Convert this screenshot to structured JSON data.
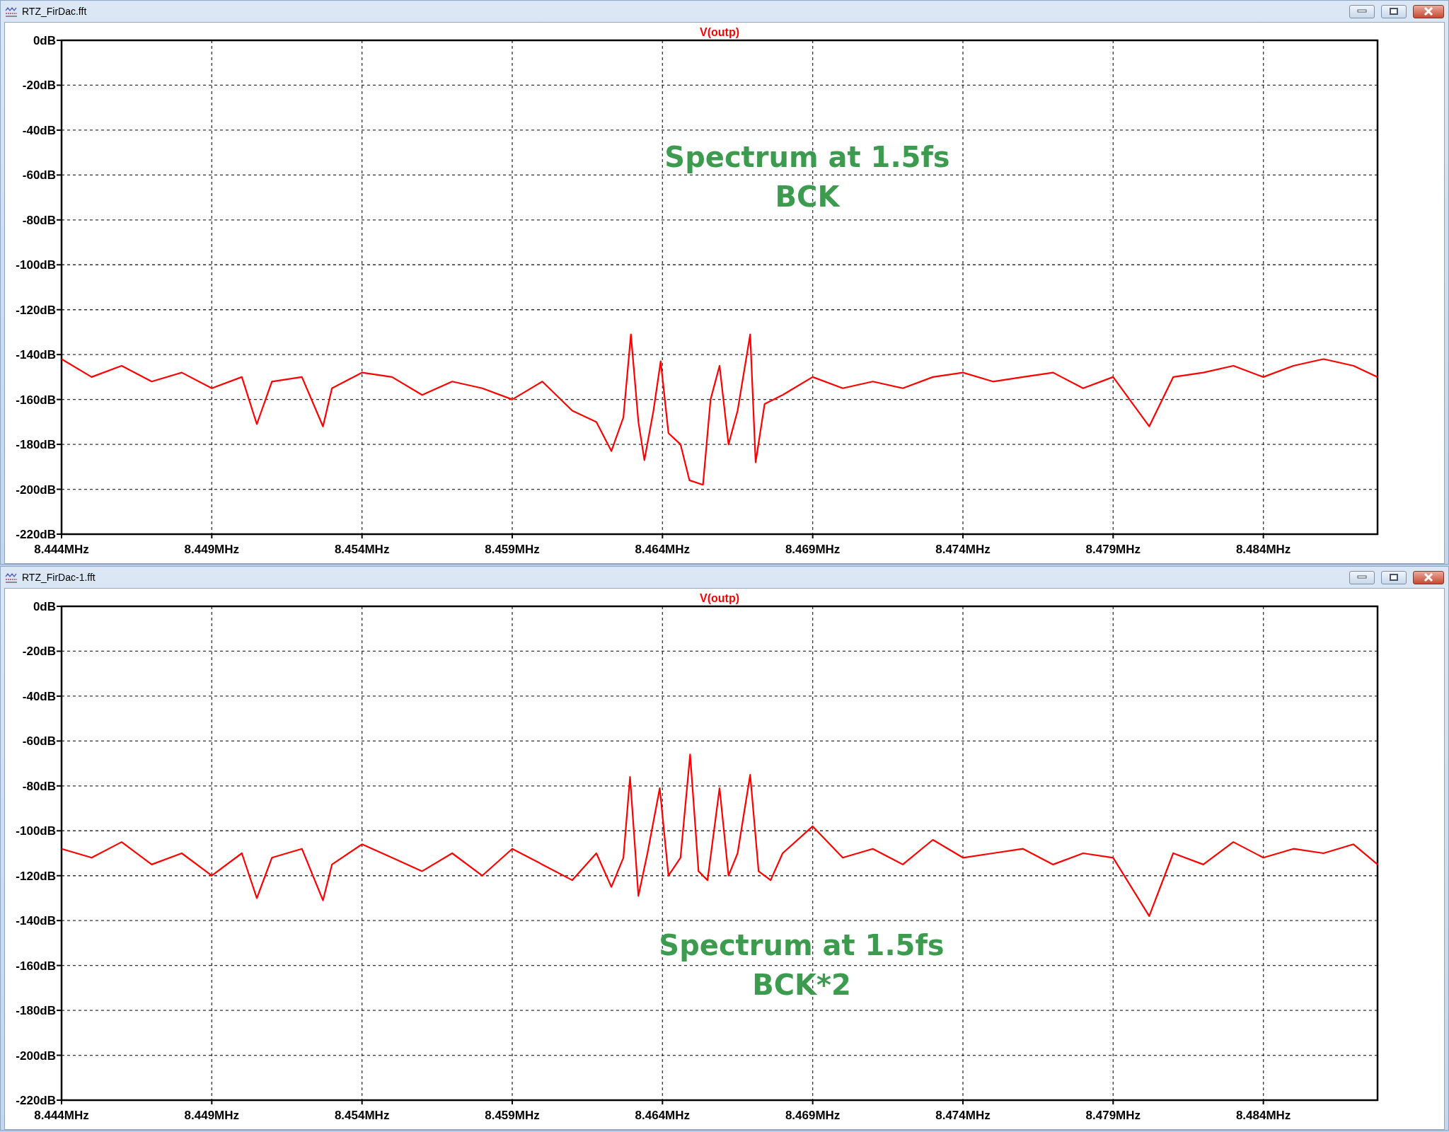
{
  "windows": [
    {
      "title": "RTZ_FirDac.fft",
      "annotation": [
        "Spectrum at 1.5fs",
        "BCK"
      ],
      "chart_data": {
        "type": "line",
        "title": "V(outp)",
        "grid": true,
        "x": [
          8.444,
          8.445,
          8.446,
          8.447,
          8.448,
          8.449,
          8.45,
          8.4505,
          8.451,
          8.452,
          8.4527,
          8.453,
          8.454,
          8.455,
          8.456,
          8.457,
          8.458,
          8.459,
          8.46,
          8.461,
          8.4618,
          8.4623,
          8.4627,
          8.46295,
          8.4632,
          8.4634,
          8.4637,
          8.46394,
          8.4642,
          8.4646,
          8.4649,
          8.46535,
          8.4656,
          8.4659,
          8.4662,
          8.4665,
          8.46692,
          8.4671,
          8.4674,
          8.468,
          8.469,
          8.47,
          8.471,
          8.472,
          8.473,
          8.474,
          8.475,
          8.476,
          8.477,
          8.478,
          8.479,
          8.4802,
          8.481,
          8.482,
          8.483,
          8.484,
          8.485,
          8.486,
          8.487,
          8.4878
        ],
        "series": [
          {
            "color": "#ff0000",
            "values": [
              -142,
              -150,
              -145,
              -152,
              -148,
              -155,
              -150,
              -171,
              -152,
              -150,
              -172,
              -155,
              -148,
              -150,
              -158,
              -152,
              -155,
              -160,
              -152,
              -165,
              -170,
              -183,
              -168,
              -131,
              -170,
              -187,
              -165,
              -143,
              -175,
              -180,
              -196,
              -198,
              -160,
              -145,
              -180,
              -165,
              -131,
              -188,
              -162,
              -158,
              -150,
              -155,
              -152,
              -155,
              -150,
              -148,
              -152,
              -150,
              -148,
              -155,
              -150,
              -172,
              -150,
              -148,
              -145,
              -150,
              -145,
              -142,
              -145,
              -150
            ]
          }
        ],
        "xlim": [
          8.444,
          8.4878
        ],
        "ylim": [
          -220,
          0
        ],
        "xticks": [
          {
            "value": 8.444,
            "label": "8.444MHz"
          },
          {
            "value": 8.449,
            "label": "8.449MHz"
          },
          {
            "value": 8.454,
            "label": "8.454MHz"
          },
          {
            "value": 8.459,
            "label": "8.459MHz"
          },
          {
            "value": 8.464,
            "label": "8.464MHz"
          },
          {
            "value": 8.469,
            "label": "8.469MHz"
          },
          {
            "value": 8.474,
            "label": "8.474MHz"
          },
          {
            "value": 8.479,
            "label": "8.479MHz"
          },
          {
            "value": 8.484,
            "label": "8.484MHz"
          }
        ],
        "yticks": [
          {
            "value": 0,
            "label": "0dB"
          },
          {
            "value": -20,
            "label": "-20dB"
          },
          {
            "value": -40,
            "label": "-40dB"
          },
          {
            "value": -60,
            "label": "-60dB"
          },
          {
            "value": -80,
            "label": "-80dB"
          },
          {
            "value": -100,
            "label": "-100dB"
          },
          {
            "value": -120,
            "label": "-120dB"
          },
          {
            "value": -140,
            "label": "-140dB"
          },
          {
            "value": -160,
            "label": "-160dB"
          },
          {
            "value": -180,
            "label": "-180dB"
          },
          {
            "value": -200,
            "label": "-200dB"
          },
          {
            "value": -220,
            "label": "-220dB"
          }
        ]
      }
    },
    {
      "title": "RTZ_FirDac-1.fft",
      "annotation": [
        "Spectrum at 1.5fs",
        "BCK*2"
      ],
      "chart_data": {
        "type": "line",
        "title": "V(outp)",
        "grid": true,
        "x": [
          8.444,
          8.445,
          8.446,
          8.447,
          8.448,
          8.449,
          8.45,
          8.4505,
          8.451,
          8.452,
          8.4527,
          8.453,
          8.454,
          8.455,
          8.456,
          8.457,
          8.458,
          8.459,
          8.46,
          8.461,
          8.4618,
          8.4623,
          8.4627,
          8.46292,
          8.4632,
          8.4635,
          8.46391,
          8.4642,
          8.4646,
          8.46492,
          8.4652,
          8.4655,
          8.4659,
          8.4662,
          8.4665,
          8.46692,
          8.4672,
          8.4676,
          8.468,
          8.469,
          8.47,
          8.471,
          8.472,
          8.473,
          8.474,
          8.475,
          8.476,
          8.477,
          8.478,
          8.479,
          8.4802,
          8.481,
          8.482,
          8.483,
          8.484,
          8.485,
          8.486,
          8.487,
          8.4878
        ],
        "series": [
          {
            "color": "#ff0000",
            "values": [
              -108,
              -112,
              -105,
              -115,
              -110,
              -120,
              -110,
              -130,
              -112,
              -108,
              -131,
              -115,
              -106,
              -112,
              -118,
              -110,
              -120,
              -108,
              -115,
              -122,
              -110,
              -125,
              -112,
              -76,
              -129,
              -110,
              -81,
              -120,
              -112,
              -66,
              -118,
              -122,
              -81,
              -120,
              -110,
              -75,
              -118,
              -122,
              -110,
              -98,
              -112,
              -108,
              -115,
              -104,
              -112,
              -110,
              -108,
              -115,
              -110,
              -112,
              -138,
              -110,
              -115,
              -105,
              -112,
              -108,
              -110,
              -106,
              -115
            ]
          }
        ],
        "xlim": [
          8.444,
          8.4878
        ],
        "ylim": [
          -220,
          0
        ],
        "xticks": [
          {
            "value": 8.444,
            "label": "8.444MHz"
          },
          {
            "value": 8.449,
            "label": "8.449MHz"
          },
          {
            "value": 8.454,
            "label": "8.454MHz"
          },
          {
            "value": 8.459,
            "label": "8.459MHz"
          },
          {
            "value": 8.464,
            "label": "8.464MHz"
          },
          {
            "value": 8.469,
            "label": "8.469MHz"
          },
          {
            "value": 8.474,
            "label": "8.474MHz"
          },
          {
            "value": 8.479,
            "label": "8.479MHz"
          },
          {
            "value": 8.484,
            "label": "8.484MHz"
          }
        ],
        "yticks": [
          {
            "value": 0,
            "label": "0dB"
          },
          {
            "value": -20,
            "label": "-20dB"
          },
          {
            "value": -40,
            "label": "-40dB"
          },
          {
            "value": -60,
            "label": "-60dB"
          },
          {
            "value": -80,
            "label": "-80dB"
          },
          {
            "value": -100,
            "label": "-100dB"
          },
          {
            "value": -120,
            "label": "-120dB"
          },
          {
            "value": -140,
            "label": "-140dB"
          },
          {
            "value": -160,
            "label": "-160dB"
          },
          {
            "value": -180,
            "label": "-180dB"
          },
          {
            "value": -200,
            "label": "-200dB"
          },
          {
            "value": -220,
            "label": "-220dB"
          }
        ]
      }
    }
  ]
}
